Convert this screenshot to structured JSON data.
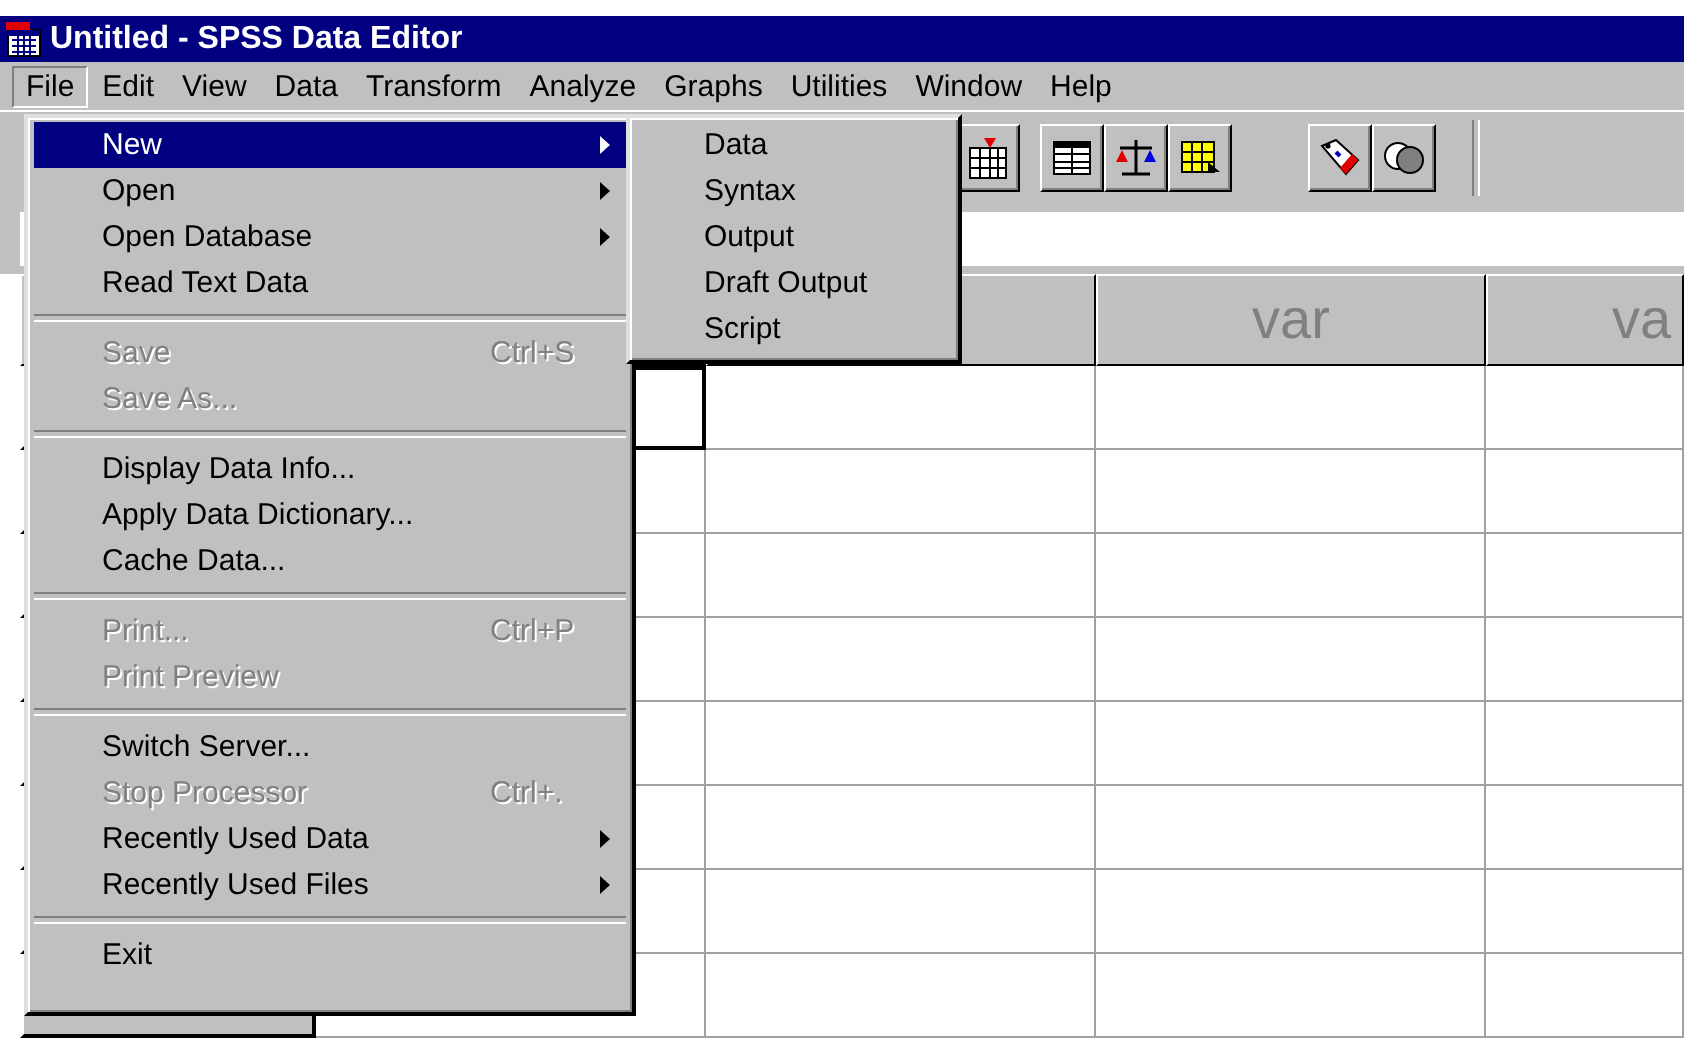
{
  "window": {
    "title": "Untitled - SPSS Data Editor"
  },
  "menubar": [
    {
      "label": "File",
      "selected": true
    },
    {
      "label": "Edit",
      "selected": false
    },
    {
      "label": "View",
      "selected": false
    },
    {
      "label": "Data",
      "selected": false
    },
    {
      "label": "Transform",
      "selected": false
    },
    {
      "label": "Analyze",
      "selected": false
    },
    {
      "label": "Graphs",
      "selected": false
    },
    {
      "label": "Utilities",
      "selected": false
    },
    {
      "label": "Window",
      "selected": false
    },
    {
      "label": "Help",
      "selected": false
    }
  ],
  "file_menu": [
    {
      "kind": "item",
      "label": "New",
      "has_submenu": true,
      "selected": true,
      "disabled": false
    },
    {
      "kind": "item",
      "label": "Open",
      "has_submenu": true,
      "selected": false,
      "disabled": false
    },
    {
      "kind": "item",
      "label": "Open Database",
      "has_submenu": true,
      "selected": false,
      "disabled": false
    },
    {
      "kind": "item",
      "label": "Read Text Data",
      "has_submenu": false,
      "selected": false,
      "disabled": false
    },
    {
      "kind": "separator"
    },
    {
      "kind": "item",
      "label": "Save",
      "shortcut": "Ctrl+S",
      "has_submenu": false,
      "selected": false,
      "disabled": true
    },
    {
      "kind": "item",
      "label": "Save As...",
      "has_submenu": false,
      "selected": false,
      "disabled": true
    },
    {
      "kind": "separator"
    },
    {
      "kind": "item",
      "label": "Display Data Info...",
      "has_submenu": false,
      "selected": false,
      "disabled": false
    },
    {
      "kind": "item",
      "label": "Apply Data Dictionary...",
      "has_submenu": false,
      "selected": false,
      "disabled": false
    },
    {
      "kind": "item",
      "label": "Cache Data...",
      "has_submenu": false,
      "selected": false,
      "disabled": false
    },
    {
      "kind": "separator"
    },
    {
      "kind": "item",
      "label": "Print...",
      "shortcut": "Ctrl+P",
      "has_submenu": false,
      "selected": false,
      "disabled": true
    },
    {
      "kind": "item",
      "label": "Print Preview",
      "has_submenu": false,
      "selected": false,
      "disabled": true
    },
    {
      "kind": "separator"
    },
    {
      "kind": "item",
      "label": "Switch Server...",
      "has_submenu": false,
      "selected": false,
      "disabled": false
    },
    {
      "kind": "item",
      "label": "Stop Processor",
      "shortcut": "Ctrl+.",
      "has_submenu": false,
      "selected": false,
      "disabled": true
    },
    {
      "kind": "item",
      "label": "Recently Used Data",
      "has_submenu": true,
      "selected": false,
      "disabled": false
    },
    {
      "kind": "item",
      "label": "Recently Used Files",
      "has_submenu": true,
      "selected": false,
      "disabled": false
    },
    {
      "kind": "separator"
    },
    {
      "kind": "item",
      "label": "Exit",
      "has_submenu": false,
      "selected": false,
      "disabled": false
    }
  ],
  "new_submenu": [
    {
      "kind": "item",
      "label": "Data",
      "has_submenu": false,
      "selected": false,
      "disabled": false
    },
    {
      "kind": "item",
      "label": "Syntax",
      "has_submenu": false,
      "selected": false,
      "disabled": false
    },
    {
      "kind": "item",
      "label": "Output",
      "has_submenu": false,
      "selected": false,
      "disabled": false
    },
    {
      "kind": "item",
      "label": "Draft Output",
      "has_submenu": false,
      "selected": false,
      "disabled": false
    },
    {
      "kind": "item",
      "label": "Script",
      "has_submenu": false,
      "selected": false,
      "disabled": false
    }
  ],
  "grid": {
    "column_headers": [
      "var",
      "va"
    ]
  }
}
